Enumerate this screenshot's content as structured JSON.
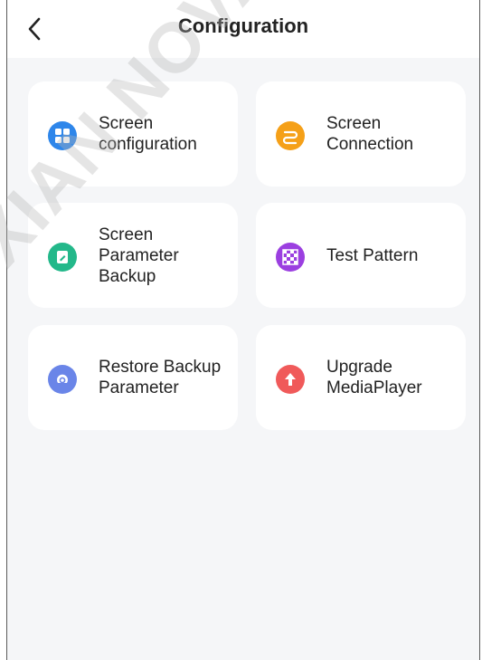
{
  "header": {
    "title": "Configuration"
  },
  "cards": [
    {
      "label": "Screen configuration",
      "icon": "grid-icon",
      "color": "#2e86ea"
    },
    {
      "label": "Screen Connection",
      "icon": "connection-icon",
      "color": "#f5a018"
    },
    {
      "label": "Screen Parameter Backup",
      "icon": "backup-icon",
      "color": "#23b88a"
    },
    {
      "label": "Test Pattern",
      "icon": "checker-icon",
      "color": "#9b3fe0"
    },
    {
      "label": "Restore Backup Parameter",
      "icon": "restore-icon",
      "color": "#6a85e8"
    },
    {
      "label": "Upgrade MediaPlayer",
      "icon": "upload-icon",
      "color": "#f05a5a"
    }
  ],
  "watermark": "XIAN NOVA"
}
